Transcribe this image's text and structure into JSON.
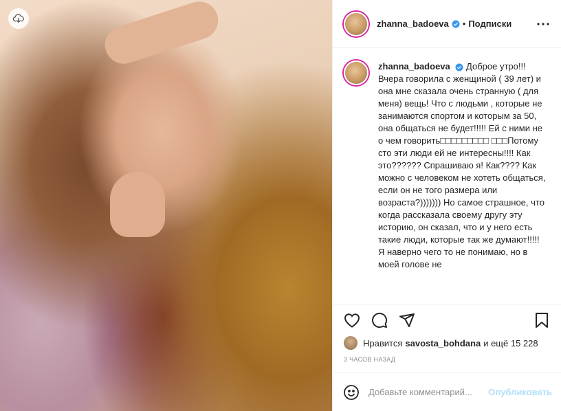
{
  "post": {
    "username": "zhanna_badoeva",
    "follow_status": "Подписки",
    "separator": "•",
    "caption_text": "Доброе утро!!! Вчера говорила с женщиной ( 39 лет) и она мне сказала очень странную ( для меня) вещь! Что с людьми , которые не занимаются спортом и которым за 50, она общаться не будет!!!!! Ей с ними не о чем говорить□□□□□□□□□ □□□Потому сто эти люди ей не интересны!!!! Как это?????? Спрашиваю я! Как???? Как можно с человеком не хотеть общаться, если он не того размера или возраста?))))))) Но самое страшное, что когда рассказала своему другу эту историю, он сказал, что и у него есть такие люди, которые так же думают!!!!! Я наверно чего то не понимаю, но в моей голове не"
  },
  "likes": {
    "prefix": "Нравится",
    "user": "savosta_bohdana",
    "suffix": "и ещё 15 228"
  },
  "time_ago": "3 ЧАСОВ НАЗАД",
  "comment": {
    "placeholder": "Добавьте комментарий...",
    "publish_label": "Опубликовать"
  },
  "colors": {
    "verified": "#3897f0",
    "publish_disabled": "#b2dffc",
    "muted": "#8e8e8e"
  },
  "icons": [
    "cloud-download-icon",
    "verified-badge-icon",
    "more-options-icon",
    "heart-icon",
    "comment-icon",
    "share-icon",
    "bookmark-icon",
    "emoji-icon"
  ]
}
